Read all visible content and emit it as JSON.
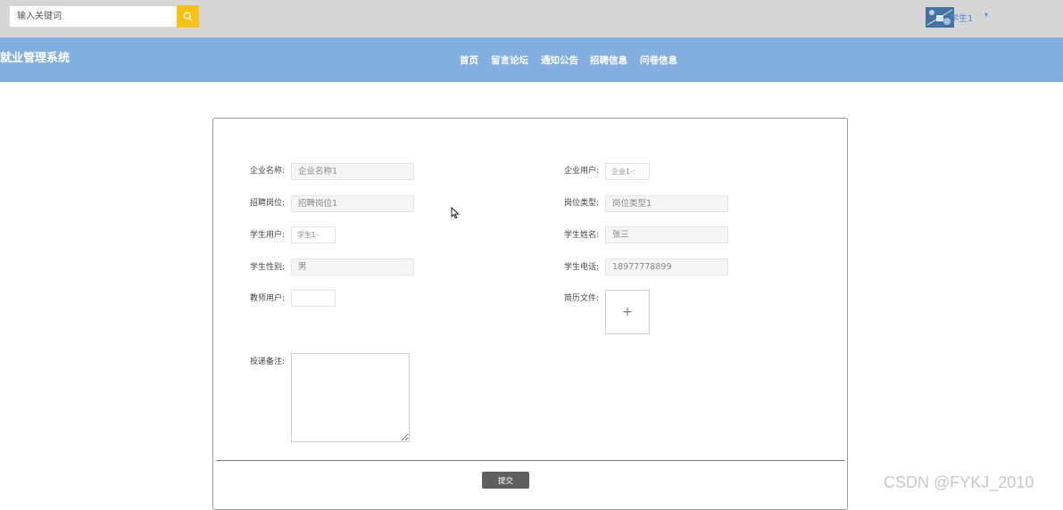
{
  "search": {
    "placeholder": "输入关键词"
  },
  "user": {
    "name": "学生1"
  },
  "site": {
    "title": "就业管理系统"
  },
  "nav": {
    "items": [
      "首页",
      "留言论坛",
      "通知公告",
      "招聘信息",
      "问卷信息"
    ]
  },
  "form": {
    "company_name_label": "企业名称:",
    "company_name_value": "企业名称1",
    "company_user_label": "企业用户:",
    "company_user_value": "企业1-:",
    "position_label": "招聘岗位:",
    "position_value": "招聘岗位1",
    "position_type_label": "岗位类型:",
    "position_type_value": "岗位类型1",
    "student_user_label": "学生用户:",
    "student_user_value": "学生1-",
    "student_name_label": "学生姓名:",
    "student_name_value": "张三",
    "student_gender_label": "学生性别:",
    "student_gender_value": "男",
    "student_phone_label": "学生电话:",
    "student_phone_value": "18977778899",
    "teacher_user_label": "教师用户:",
    "teacher_user_value": "",
    "resume_label": "简历文件:",
    "upload_symbol": "+",
    "notes_label": "投递备注:",
    "submit_label": "提交"
  },
  "watermark": "CSDN @FYKJ_2010"
}
